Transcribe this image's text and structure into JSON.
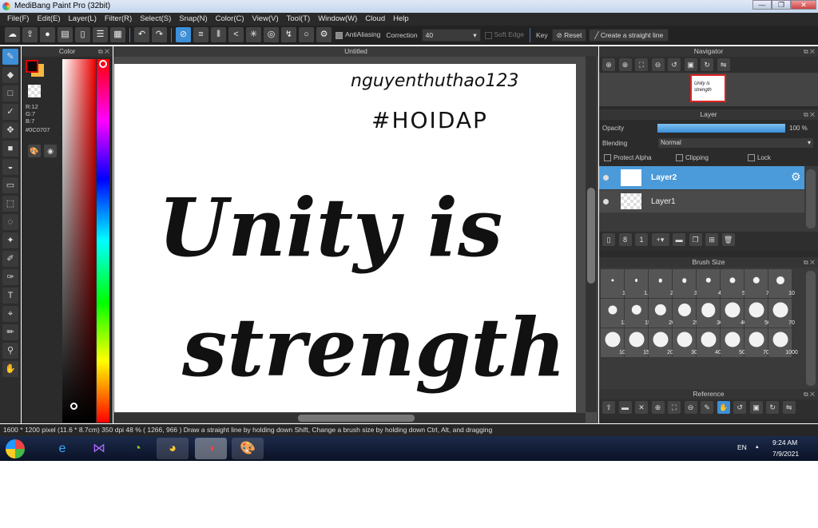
{
  "window": {
    "title": "MediBang Paint Pro (32bit)",
    "minimize": "—",
    "restore": "❐",
    "close": "✕"
  },
  "menu": [
    "File(F)",
    "Edit(E)",
    "Layer(L)",
    "Filter(R)",
    "Select(S)",
    "Snap(N)",
    "Color(C)",
    "View(V)",
    "Tool(T)",
    "Window(W)",
    "Cloud",
    "Help"
  ],
  "toolbar": {
    "antialiasing": "AntiAliasing",
    "correction_label": "Correction",
    "correction_value": "40",
    "soft_edge": "Soft Edge",
    "key": "Key",
    "reset": "Reset",
    "create_line": "Create a straight line"
  },
  "color": {
    "title": "Color",
    "r": "R:12",
    "g": "G:7",
    "b": "B:7",
    "hex": "#0C0707",
    "primary": "#0C0707",
    "secondary": "#f4b942"
  },
  "canvas": {
    "tab": "Untitled",
    "line1": "Unity is",
    "line2": "strength",
    "signature": "nguyenthuthao123",
    "hashtag": "#HOIDAP"
  },
  "navigator": {
    "title": "Navigator"
  },
  "layer": {
    "title": "Layer",
    "opacity_label": "Opacity",
    "opacity_value": "100 %",
    "opacity": 100,
    "blending_label": "Blending",
    "blending_value": "Normal",
    "protect_alpha": "Protect Alpha",
    "clipping": "Clipping",
    "lock": "Lock",
    "layers": [
      {
        "name": "Layer2",
        "selected": true
      },
      {
        "name": "Layer1",
        "selected": false
      }
    ]
  },
  "brush_size": {
    "title": "Brush Size",
    "sizes": [
      "1",
      "1.5",
      "2",
      "3",
      "4",
      "5",
      "7",
      "10",
      "12",
      "15",
      "20",
      "25",
      "30",
      "40",
      "50",
      "70",
      "100",
      "150",
      "200",
      "300",
      "400",
      "500",
      "700",
      "1000"
    ]
  },
  "reference": {
    "title": "Reference"
  },
  "status": {
    "text": "1600 * 1200 pixel  (11.6 * 8.7cm)  350 dpi  48 %  ( 1266, 966 )  Draw a straight line by holding down Shift, Change a brush size by holding down Ctrl, Alt, and dragging"
  },
  "taskbar": {
    "lang": "EN",
    "time": "9:24 AM",
    "date": "7/9/2021"
  }
}
